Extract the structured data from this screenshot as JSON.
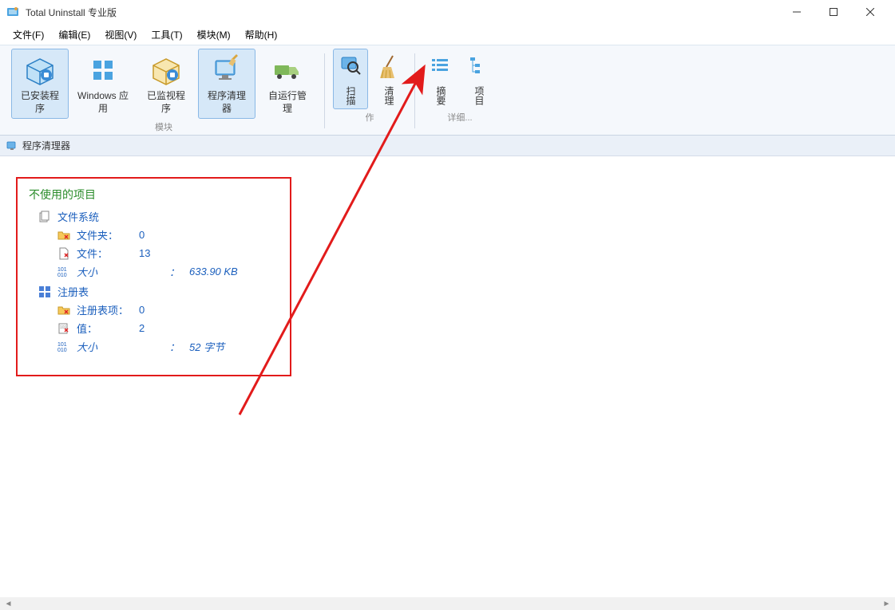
{
  "titlebar": {
    "title": "Total Uninstall 专业版"
  },
  "menu": {
    "items": [
      "文件(F)",
      "编辑(E)",
      "视图(V)",
      "工具(T)",
      "模块(M)",
      "帮助(H)"
    ]
  },
  "ribbon": {
    "groups": [
      {
        "label": "模块",
        "items": [
          {
            "id": "installed-programs",
            "label": "已安装程\n序",
            "selected": true,
            "icon": "box-icon"
          },
          {
            "id": "windows-apps",
            "label": "Windows 应\n用",
            "icon": "apps-icon"
          },
          {
            "id": "monitored-programs",
            "label": "已监视程\n序",
            "icon": "box-monitor-icon"
          },
          {
            "id": "program-cleaner",
            "label": "程序清理\n器",
            "selected": true,
            "icon": "cleaner-icon"
          },
          {
            "id": "autorun-manager",
            "label": "自运行管\n理",
            "icon": "truck-icon"
          }
        ]
      },
      {
        "label": "作",
        "small": true,
        "items": [
          {
            "id": "scan",
            "label": "扫描",
            "selected": true,
            "icon": "magnifier-icon"
          },
          {
            "id": "clean",
            "label": "清理",
            "icon": "broom-icon"
          }
        ]
      },
      {
        "label": "详细...",
        "small": true,
        "items": [
          {
            "id": "summary",
            "label": "摘要",
            "icon": "list-icon"
          },
          {
            "id": "items",
            "label": "项目",
            "icon": "tree-icon"
          }
        ]
      }
    ]
  },
  "panel": {
    "title": "程序清理器"
  },
  "summary": {
    "title": "不使用的项目",
    "filesystem": {
      "label": "文件系统",
      "folders_label": "文件夹：",
      "folders": "0",
      "files_label": "文件：",
      "files": "13",
      "size_label": "大小",
      "size_sep": "：",
      "size": "633.90 KB"
    },
    "registry": {
      "label": "注册表",
      "keys_label": "注册表项：",
      "keys": "0",
      "values_label": "值：",
      "values": "2",
      "size_label": "大小",
      "size_sep": "：",
      "size": "52 字节"
    }
  }
}
